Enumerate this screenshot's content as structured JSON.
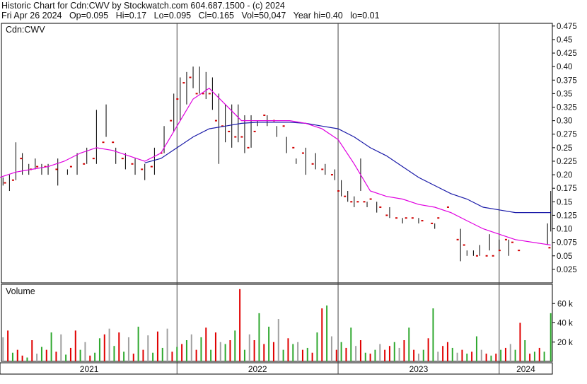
{
  "header": {
    "line1": "Historic Chart for Cdn:CWV by Stockwatch.com 604.687.1500 - (c) 2024",
    "date": "Fri Apr 26 2024",
    "open": "Op=0.095",
    "high": "Hi=0.17",
    "low": "Lo=0.095",
    "close": "Cl=0.165",
    "volume": "Vol=50,047",
    "year_high": "Year hi=0.40",
    "year_low": "lo=0.01"
  },
  "price_panel_label": "Cdn:CWV",
  "volume_panel_label": "Volume",
  "colors": {
    "ma_short": "#e000e0",
    "ma_long": "#1a1aa8",
    "bar_up": "#2fa82f",
    "bar_down": "#e00000",
    "bar_flat": "#a0a0a0",
    "close_tick": "#d00000",
    "price_line": "#000000"
  },
  "chart_data": [
    {
      "type": "line",
      "title": "Cdn:CWV",
      "ylim": [
        0.0,
        0.48
      ],
      "y_ticks": [
        "0.475",
        "0.45",
        "0.425",
        "0.40",
        "0.375",
        "0.35",
        "0.325",
        "0.30",
        "0.275",
        "0.25",
        "0.225",
        "0.20",
        "0.175",
        "0.15",
        "0.125",
        "0.10",
        "0.075",
        "0.05",
        "0.025"
      ],
      "x_labels": [
        "2021",
        "2022",
        "2023",
        "2024"
      ],
      "series": [
        {
          "kind": "ma_short",
          "x": [
            2020.9,
            2021.0,
            2021.1,
            2021.2,
            2021.3,
            2021.4,
            2021.5,
            2021.6,
            2021.7,
            2021.8,
            2021.9,
            2022.0,
            2022.1,
            2022.2,
            2022.3,
            2022.4,
            2022.5,
            2022.6,
            2022.7,
            2022.8,
            2022.9,
            2023.0,
            2023.1,
            2023.2,
            2023.3,
            2023.4,
            2023.5,
            2023.6,
            2023.7,
            2023.8,
            2023.9,
            2024.0,
            2024.1,
            2024.32
          ],
          "y": [
            0.195,
            0.205,
            0.21,
            0.215,
            0.225,
            0.24,
            0.25,
            0.245,
            0.235,
            0.225,
            0.24,
            0.29,
            0.34,
            0.36,
            0.33,
            0.3,
            0.3,
            0.3,
            0.3,
            0.295,
            0.285,
            0.265,
            0.22,
            0.17,
            0.16,
            0.155,
            0.145,
            0.14,
            0.13,
            0.115,
            0.1,
            0.09,
            0.08,
            0.07
          ]
        },
        {
          "kind": "ma_long",
          "x": [
            2021.8,
            2021.9,
            2022.0,
            2022.1,
            2022.2,
            2022.3,
            2022.4,
            2022.5,
            2022.6,
            2022.7,
            2022.8,
            2022.9,
            2023.0,
            2023.1,
            2023.2,
            2023.3,
            2023.4,
            2023.5,
            2023.6,
            2023.7,
            2023.8,
            2023.9,
            2024.0,
            2024.1,
            2024.32
          ],
          "y": [
            0.222,
            0.23,
            0.25,
            0.27,
            0.285,
            0.29,
            0.295,
            0.297,
            0.297,
            0.297,
            0.295,
            0.29,
            0.285,
            0.27,
            0.25,
            0.235,
            0.215,
            0.195,
            0.18,
            0.165,
            0.155,
            0.14,
            0.135,
            0.13,
            0.13
          ]
        },
        {
          "kind": "price_hilo",
          "x": [
            2020.92,
            2020.96,
            2021.0,
            2021.04,
            2021.08,
            2021.12,
            2021.16,
            2021.2,
            2021.26,
            2021.32,
            2021.38,
            2021.44,
            2021.5,
            2021.56,
            2021.62,
            2021.68,
            2021.74,
            2021.8,
            2021.86,
            2021.92,
            2021.98,
            2022.02,
            2022.06,
            2022.1,
            2022.14,
            2022.18,
            2022.22,
            2022.26,
            2022.3,
            2022.34,
            2022.38,
            2022.42,
            2022.46,
            2022.5,
            2022.56,
            2022.62,
            2022.68,
            2022.74,
            2022.8,
            2022.86,
            2022.92,
            2022.98,
            2023.02,
            2023.06,
            2023.1,
            2023.14,
            2023.18,
            2023.24,
            2023.32,
            2023.4,
            2023.5,
            2023.6,
            2023.7,
            2023.76,
            2023.8,
            2023.84,
            2023.88,
            2023.94,
            2024.0,
            2024.06,
            2024.3,
            2024.32
          ],
          "high": [
            0.195,
            0.2,
            0.26,
            0.24,
            0.22,
            0.23,
            0.22,
            0.22,
            0.23,
            0.21,
            0.24,
            0.25,
            0.32,
            0.33,
            0.25,
            0.24,
            0.23,
            0.22,
            0.25,
            0.29,
            0.35,
            0.38,
            0.39,
            0.4,
            0.4,
            0.39,
            0.38,
            0.35,
            0.33,
            0.33,
            0.33,
            0.31,
            0.31,
            0.3,
            0.31,
            0.29,
            0.27,
            0.23,
            0.25,
            0.24,
            0.22,
            0.21,
            0.19,
            0.17,
            0.16,
            0.23,
            0.15,
            0.15,
            0.14,
            0.12,
            0.12,
            0.11,
            0.07,
            0.1,
            0.06,
            0.06,
            0.07,
            0.09,
            0.08,
            0.08,
            0.11,
            0.17
          ],
          "low": [
            0.18,
            0.17,
            0.19,
            0.2,
            0.2,
            0.21,
            0.2,
            0.2,
            0.18,
            0.2,
            0.2,
            0.22,
            0.22,
            0.27,
            0.22,
            0.21,
            0.2,
            0.19,
            0.2,
            0.24,
            0.28,
            0.3,
            0.33,
            0.36,
            0.35,
            0.34,
            0.32,
            0.22,
            0.26,
            0.25,
            0.26,
            0.24,
            0.25,
            0.29,
            0.29,
            0.27,
            0.24,
            0.22,
            0.2,
            0.21,
            0.2,
            0.19,
            0.16,
            0.15,
            0.14,
            0.17,
            0.14,
            0.13,
            0.12,
            0.11,
            0.11,
            0.1,
            0.07,
            0.04,
            0.05,
            0.05,
            0.05,
            0.06,
            0.06,
            0.05,
            0.07,
            0.095
          ]
        },
        {
          "kind": "close_ticks",
          "x": [
            2020.93,
            2020.98,
            2021.03,
            2021.09,
            2021.13,
            2021.18,
            2021.25,
            2021.34,
            2021.42,
            2021.48,
            2021.54,
            2021.6,
            2021.66,
            2021.72,
            2021.78,
            2021.84,
            2021.9,
            2021.96,
            2022.0,
            2022.04,
            2022.08,
            2022.12,
            2022.16,
            2022.2,
            2022.24,
            2022.28,
            2022.32,
            2022.36,
            2022.4,
            2022.44,
            2022.48,
            2022.54,
            2022.6,
            2022.66,
            2022.72,
            2022.78,
            2022.84,
            2022.9,
            2022.96,
            2023.0,
            2023.04,
            2023.08,
            2023.12,
            2023.16,
            2023.2,
            2023.26,
            2023.3,
            2023.36,
            2023.42,
            2023.46,
            2023.52,
            2023.58,
            2023.62,
            2023.68,
            2023.74,
            2023.78,
            2023.86,
            2023.92,
            2023.96,
            2024.0,
            2024.04,
            2024.08,
            2024.12,
            2024.31
          ],
          "y": [
            0.185,
            0.19,
            0.23,
            0.21,
            0.215,
            0.215,
            0.21,
            0.215,
            0.22,
            0.23,
            0.26,
            0.26,
            0.23,
            0.22,
            0.21,
            0.215,
            0.24,
            0.3,
            0.34,
            0.37,
            0.38,
            0.35,
            0.35,
            0.35,
            0.3,
            0.29,
            0.28,
            0.27,
            0.27,
            0.25,
            0.28,
            0.31,
            0.3,
            0.29,
            0.25,
            0.24,
            0.22,
            0.21,
            0.2,
            0.17,
            0.16,
            0.15,
            0.15,
            0.15,
            0.155,
            0.14,
            0.125,
            0.12,
            0.12,
            0.12,
            0.115,
            0.11,
            0.12,
            0.14,
            0.08,
            0.07,
            0.05,
            0.05,
            0.05,
            0.06,
            0.08,
            0.075,
            0.06,
            0.065
          ]
        }
      ]
    },
    {
      "type": "bar",
      "title": "Volume",
      "ylim": [
        0,
        80000
      ],
      "y_ticks": [
        "60 k",
        "40 k",
        "20 k"
      ],
      "x": [
        2020.92,
        2020.95,
        2020.98,
        2021.01,
        2021.04,
        2021.07,
        2021.1,
        2021.13,
        2021.16,
        2021.19,
        2021.22,
        2021.25,
        2021.28,
        2021.31,
        2021.34,
        2021.37,
        2021.4,
        2021.43,
        2021.46,
        2021.49,
        2021.52,
        2021.55,
        2021.58,
        2021.61,
        2021.64,
        2021.67,
        2021.7,
        2021.73,
        2021.76,
        2021.79,
        2021.82,
        2021.85,
        2021.88,
        2021.91,
        2021.94,
        2021.97,
        2022.0,
        2022.03,
        2022.06,
        2022.09,
        2022.12,
        2022.15,
        2022.18,
        2022.21,
        2022.24,
        2022.27,
        2022.3,
        2022.33,
        2022.36,
        2022.39,
        2022.42,
        2022.45,
        2022.48,
        2022.51,
        2022.54,
        2022.57,
        2022.6,
        2022.63,
        2022.66,
        2022.69,
        2022.72,
        2022.75,
        2022.78,
        2022.81,
        2022.84,
        2022.87,
        2022.9,
        2022.93,
        2022.96,
        2022.99,
        2023.02,
        2023.05,
        2023.08,
        2023.11,
        2023.14,
        2023.17,
        2023.2,
        2023.23,
        2023.26,
        2023.29,
        2023.32,
        2023.35,
        2023.38,
        2023.41,
        2023.44,
        2023.47,
        2023.5,
        2023.53,
        2023.56,
        2023.59,
        2023.62,
        2023.65,
        2023.68,
        2023.71,
        2023.74,
        2023.77,
        2023.8,
        2023.83,
        2023.86,
        2023.89,
        2023.92,
        2023.95,
        2023.98,
        2024.01,
        2024.04,
        2024.07,
        2024.1,
        2024.13,
        2024.16,
        2024.19,
        2024.22,
        2024.25,
        2024.28,
        2024.32
      ],
      "values": [
        25000,
        32000,
        9000,
        12000,
        6000,
        4000,
        22000,
        8000,
        15000,
        12000,
        30000,
        10000,
        28000,
        7000,
        14000,
        32000,
        12000,
        20000,
        6000,
        9000,
        24000,
        28000,
        34000,
        16000,
        30000,
        10000,
        25000,
        8000,
        36000,
        12000,
        27000,
        9000,
        31000,
        14000,
        34000,
        10000,
        15000,
        18000,
        22000,
        28000,
        12000,
        25000,
        35000,
        12000,
        30000,
        20000,
        18000,
        22000,
        32000,
        75000,
        12000,
        28000,
        22000,
        50000,
        18000,
        36000,
        20000,
        44000,
        12000,
        24000,
        18000,
        20000,
        12000,
        14000,
        9000,
        30000,
        55000,
        58000,
        26000,
        12000,
        20000,
        14000,
        35000,
        16000,
        22000,
        9000,
        8000,
        12000,
        18000,
        12000,
        16000,
        20000,
        14000,
        22000,
        35000,
        12000,
        8000,
        12000,
        24000,
        55000,
        10000,
        16000,
        20000,
        14000,
        9000,
        12000,
        8000,
        10000,
        26000,
        12000,
        8000,
        6000,
        8000,
        12000,
        14000,
        18000,
        12000,
        40000,
        22000,
        8000,
        10000,
        14000,
        10000,
        50000
      ],
      "direction": [
        "flat",
        "down",
        "up",
        "down",
        "down",
        "up",
        "down",
        "flat",
        "up",
        "down",
        "up",
        "down",
        "flat",
        "up",
        "down",
        "down",
        "up",
        "flat",
        "down",
        "up",
        "up",
        "down",
        "flat",
        "up",
        "down",
        "up",
        "flat",
        "down",
        "up",
        "down",
        "flat",
        "up",
        "down",
        "up",
        "flat",
        "down",
        "up",
        "down",
        "up",
        "flat",
        "down",
        "up",
        "down",
        "up",
        "down",
        "flat",
        "up",
        "down",
        "up",
        "down",
        "up",
        "flat",
        "down",
        "up",
        "down",
        "up",
        "down",
        "flat",
        "up",
        "down",
        "up",
        "flat",
        "down",
        "up",
        "down",
        "up",
        "down",
        "up",
        "flat",
        "down",
        "up",
        "down",
        "up",
        "flat",
        "down",
        "up",
        "down",
        "up",
        "flat",
        "down",
        "down",
        "up",
        "flat",
        "down",
        "up",
        "down",
        "flat",
        "up",
        "down",
        "up",
        "flat",
        "down",
        "down",
        "up",
        "flat",
        "down",
        "up",
        "down",
        "up",
        "flat",
        "down",
        "up",
        "down",
        "up",
        "down",
        "flat",
        "up",
        "down",
        "up",
        "down",
        "up",
        "down",
        "up",
        "up"
      ]
    }
  ]
}
